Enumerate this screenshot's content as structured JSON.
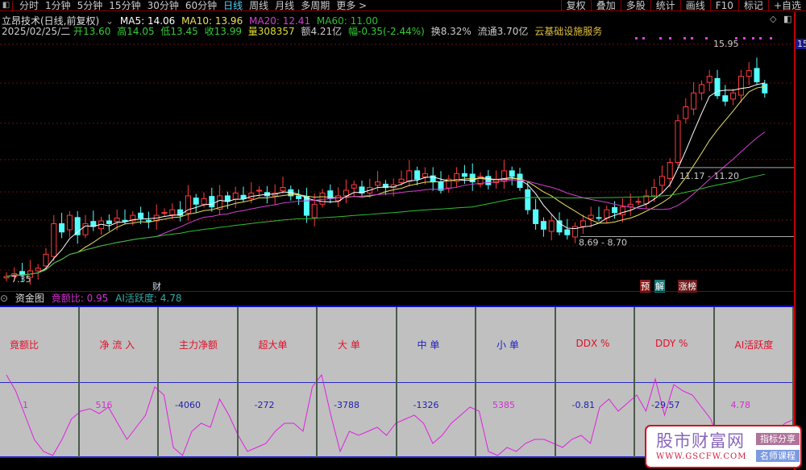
{
  "toolbar": {
    "periods": [
      "分时",
      "1分钟",
      "5分钟",
      "15分钟",
      "30分钟",
      "60分钟",
      "日线",
      "周线",
      "月线",
      "多周期",
      "更多 >"
    ],
    "active_index": 6,
    "right_buttons": [
      "复权",
      "叠加",
      "多股",
      "统计",
      "画线",
      "F10",
      "标记",
      "+自选"
    ]
  },
  "stock": {
    "title": "立昂技术(日线,前复权)",
    "ma5": "MA5: 14.06",
    "ma10": "MA10: 13.96",
    "ma20": "MA20: 12.41",
    "ma60": "MA60: 11.00",
    "date": "2025/02/25/二",
    "open": "开13.60",
    "high": "高14.05",
    "low": "低13.45",
    "close": "收13.99",
    "volume": "量308357",
    "amount": "额4.21亿",
    "change": "幅-0.35(-2.44%)",
    "turnover": "换8.32%",
    "float": "流通3.70亿",
    "sector": "云基础设施服务"
  },
  "colors": {
    "up": "#ff3b3b",
    "down": "#54ffff",
    "ma5": "#ffffff",
    "ma10": "#e8e060",
    "ma20": "#d040d0",
    "ma60": "#30c030"
  },
  "chart_data": {
    "type": "candlestick",
    "closes": [
      7.4,
      7.5,
      7.45,
      7.6,
      7.7,
      8.2,
      9.3,
      9.0,
      9.6,
      8.9,
      9.3,
      9.2,
      9.4,
      9.3,
      9.5,
      9.4,
      9.6,
      9.5,
      9.4,
      9.6,
      9.7,
      9.8,
      9.6,
      10.3,
      10.0,
      10.2,
      9.9,
      10.3,
      10.1,
      10.4,
      10.2,
      10.4,
      10.5,
      10.3,
      10.4,
      10.6,
      10.3,
      10.2,
      9.6,
      10.0,
      10.4,
      10.2,
      10.3,
      10.5,
      10.7,
      10.4,
      10.6,
      10.8,
      10.6,
      10.7,
      10.9,
      11.2,
      10.9,
      11.1,
      10.8,
      10.5,
      10.9,
      11.1,
      11.0,
      10.8,
      11.0,
      10.7,
      10.9,
      11.2,
      11.0,
      10.6,
      9.8,
      9.3,
      9.1,
      9.4,
      9.0,
      8.9,
      9.2,
      9.4,
      9.6,
      9.5,
      9.8,
      9.7,
      9.9,
      10.0,
      10.1,
      10.3,
      10.6,
      11.0,
      11.5,
      13.0,
      13.5,
      14.0,
      14.3,
      14.6,
      13.9,
      13.7,
      14.0,
      14.6,
      14.8,
      14.4,
      14.0
    ],
    "annotations": {
      "high_label": "15.95",
      "low_label": "8.69 - 8.70",
      "mid_label": "11.17 - 11.20",
      "start_label": "7.35",
      "high": 15.95,
      "low": 8.69,
      "mid": 11.2
    }
  },
  "markers": {
    "cai": "财",
    "yu": "预",
    "jie": "解",
    "zhangbang": "涨榜"
  },
  "lower": {
    "title": "资金图",
    "ratio": "竟额比: 0.95",
    "ai": "AI活跃度: 4.78",
    "columns": [
      {
        "label": "竟额比",
        "value": "1",
        "vc": "#d030d0"
      },
      {
        "label": "净 流 入",
        "value": "516",
        "vc": "#d030d0"
      },
      {
        "label": "主力净额",
        "value": "-4060",
        "vc": "#2020b0"
      },
      {
        "label": "超大单",
        "value": "-272",
        "vc": "#2020b0"
      },
      {
        "label": "大  单",
        "value": "-3788",
        "vc": "#2020b0"
      },
      {
        "label": "中  单",
        "value": "-1326",
        "vc": "#2020b0",
        "lc": "#2020c0"
      },
      {
        "label": "小  单",
        "value": "5385",
        "vc": "#d030d0",
        "lc": "#2020c0"
      },
      {
        "label": "DDX %",
        "value": "-0.81",
        "vc": "#2020b0"
      },
      {
        "label": "DDY %",
        "value": "-29.57",
        "vc": "#2020b0"
      },
      {
        "label": "AI活跃度",
        "value": "4.78",
        "vc": "#d030d0"
      }
    ],
    "line": [
      100,
      80,
      50,
      20,
      5,
      0,
      20,
      45,
      55,
      58,
      52,
      60,
      40,
      20,
      35,
      50,
      85,
      75,
      10,
      0,
      30,
      40,
      35,
      70,
      50,
      25,
      5,
      10,
      15,
      30,
      40,
      40,
      30,
      85,
      100,
      50,
      5,
      30,
      25,
      30,
      35,
      25,
      40,
      45,
      50,
      40,
      15,
      25,
      40,
      50,
      60,
      55,
      5,
      0,
      10,
      5,
      15,
      20,
      20,
      15,
      10,
      20,
      25,
      15,
      60,
      70,
      55,
      65,
      75,
      55,
      95,
      50,
      88,
      80,
      75,
      60,
      45,
      10,
      0,
      5,
      30,
      35,
      20,
      30,
      40,
      45
    ]
  },
  "watermark": {
    "title": "股市财富网",
    "url": "WWW.GSCFW.COM",
    "b1": "指标分享",
    "b2": "名师课程"
  },
  "axis": {
    "price_tag": "15"
  }
}
